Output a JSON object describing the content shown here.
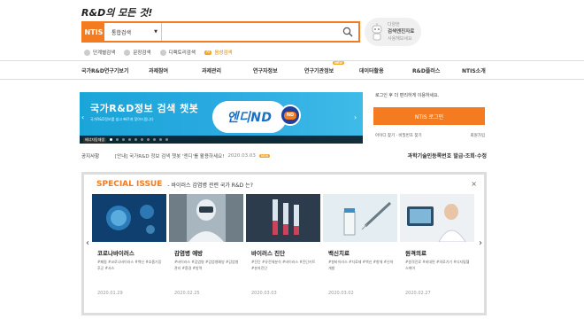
{
  "header": {
    "slogan": "R&D의 모든 것!",
    "logo": "NTIS"
  },
  "search": {
    "scope": "통합검색",
    "placeholder": ""
  },
  "assistant": {
    "line1": "다양한",
    "line2": "검색엔진자료",
    "line3": "사용해보세요"
  },
  "options": [
    "단계별검색",
    "문장검색",
    "디렉토리검색"
  ],
  "ai_badge": "AI",
  "ai_option": "음성검색",
  "nav": [
    {
      "label": "국가R&D연구기보기"
    },
    {
      "label": "과제참여"
    },
    {
      "label": "과제관리"
    },
    {
      "label": "연구자정보"
    },
    {
      "label": "연구기관정보",
      "badge": "NEW"
    },
    {
      "label": "데이터활용"
    },
    {
      "label": "R&D플러스"
    },
    {
      "label": "NTIS소개"
    }
  ],
  "banner": {
    "title": "국가R&D정보 검색 챗봇",
    "subtitle": "국가R&D정보를 쉽고 빠르게 찾아드립니다",
    "brand": "엔디ND",
    "brand_small": "ND",
    "play_label": "배너자동재생"
  },
  "login": {
    "message": "로그인 후 더 편리하게 이용하세요.",
    "button": "NTIS 로그인",
    "find": "아이디 찾기 · 비밀번호 찾기",
    "join": "회원가입"
  },
  "notice": {
    "label": "공지사항",
    "text": "[안내] 국가R&D 정보 검색 챗봇 '엔디'를 활용하세요!",
    "date": "2020.03.03",
    "badge": "NEW",
    "cert": "과학기술인등록번호 발급·조회·수정"
  },
  "special": {
    "title": "SPECIAL ISSUE",
    "subtitle": "- 바이러스 감염병 관련 국가 R&D 는?",
    "close": "×",
    "prev": "‹",
    "next": "›"
  },
  "cards": [
    {
      "name": "코로나바이러스",
      "tags": "#폐렴 #코로나바이러스 #백신 #호흡기증후군 #사스",
      "date": "2020.01.29"
    },
    {
      "name": "감염병 예방",
      "tags": "#바이러스 #감염병 #감염병예방 #감염병관리 #환경 #방역",
      "date": "2020.02.25"
    },
    {
      "name": "바이러스 진단",
      "tags": "#진단 #유전체분석 #바이러스 #진단키트 #분자진단",
      "date": "2020.03.03"
    },
    {
      "name": "백신치료",
      "tags": "#항바이러스 #치료제 #백신 #항체 #신약개발",
      "date": "2020.03.02"
    },
    {
      "name": "원격의료",
      "tags": "#원격진료 #비대면 #의료기기 #디지털헬스케어",
      "date": "2020.02.27"
    }
  ]
}
